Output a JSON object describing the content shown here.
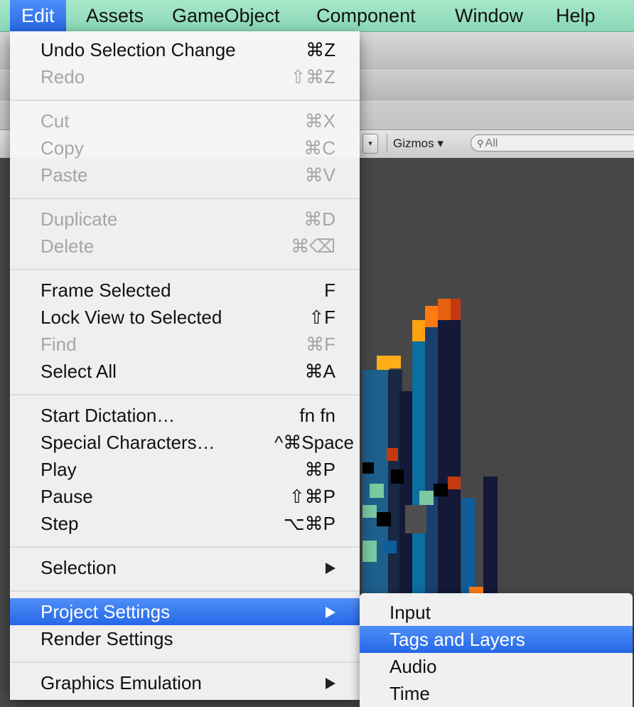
{
  "menubar": {
    "items": [
      "Edit",
      "Assets",
      "GameObject",
      "Component",
      "Window",
      "Help"
    ],
    "active": "Edit"
  },
  "scene_toolbar": {
    "gizmos_label": "Gizmos ▾",
    "search_placeholder": "All"
  },
  "edit_menu": {
    "items": [
      {
        "label": "Undo Selection Change",
        "shortcut": "⌘Z",
        "enabled": true
      },
      {
        "label": "Redo",
        "shortcut": "⇧⌘Z",
        "enabled": false
      },
      {
        "label": "Cut",
        "shortcut": "⌘X",
        "enabled": false
      },
      {
        "label": "Copy",
        "shortcut": "⌘C",
        "enabled": false
      },
      {
        "label": "Paste",
        "shortcut": "⌘V",
        "enabled": false
      },
      {
        "label": "Duplicate",
        "shortcut": "⌘D",
        "enabled": false
      },
      {
        "label": "Delete",
        "shortcut": "⌘⌫",
        "enabled": false
      },
      {
        "label": "Frame Selected",
        "shortcut": "F",
        "enabled": true
      },
      {
        "label": "Lock View to Selected",
        "shortcut": "⇧F",
        "enabled": true
      },
      {
        "label": "Find",
        "shortcut": "⌘F",
        "enabled": false
      },
      {
        "label": "Select All",
        "shortcut": "⌘A",
        "enabled": true
      },
      {
        "label": "Start Dictation…",
        "shortcut": "fn fn",
        "enabled": true
      },
      {
        "label": "Special Characters…",
        "shortcut": "^⌘Space",
        "enabled": true
      },
      {
        "label": "Play",
        "shortcut": "⌘P",
        "enabled": true
      },
      {
        "label": "Pause",
        "shortcut": "⇧⌘P",
        "enabled": true
      },
      {
        "label": "Step",
        "shortcut": "⌥⌘P",
        "enabled": true
      },
      {
        "label": "Selection",
        "submenu": true,
        "enabled": true
      },
      {
        "label": "Project Settings",
        "submenu": true,
        "enabled": true,
        "highlighted": true
      },
      {
        "label": "Render Settings",
        "enabled": true
      },
      {
        "label": "Graphics Emulation",
        "submenu": true,
        "enabled": true
      }
    ]
  },
  "project_settings_submenu": {
    "items": [
      {
        "label": "Input"
      },
      {
        "label": "Tags and Layers",
        "highlighted": true
      },
      {
        "label": "Audio"
      },
      {
        "label": "Time"
      }
    ]
  },
  "colors": {
    "menubar_bg": "#98dfc0",
    "highlight": "#3a7bf0",
    "disabled_text": "#a6a6a6"
  }
}
